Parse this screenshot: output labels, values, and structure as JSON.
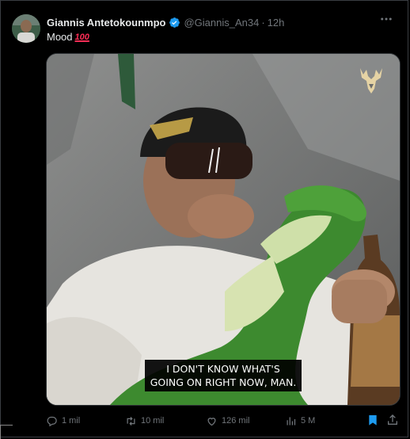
{
  "tweet": {
    "author_name": "Giannis Antetokounmpo",
    "handle": "@Giannis_An34",
    "separator": "·",
    "timestamp": "12h",
    "text": "Mood",
    "emoji": "100"
  },
  "media": {
    "caption_line1": "I DON'T KNOW WHAT'S",
    "caption_line2": "GOING ON RIGHT NOW, MAN.",
    "logo": "bucks-deer-logo"
  },
  "actions": {
    "replies": "1 mil",
    "retweets": "10 mil",
    "likes": "126 mil",
    "views": "5 M"
  },
  "icons": {
    "more": "more-icon",
    "reply": "reply-icon",
    "retweet": "retweet-icon",
    "like": "heart-icon",
    "views": "views-icon",
    "bookmark": "bookmark-icon",
    "share": "share-icon",
    "verified": "verified-badge-icon"
  },
  "colors": {
    "background": "#000000",
    "text": "#e7e9ea",
    "muted": "#71767b",
    "accent": "#1d9bf0",
    "bucks_gold": "#e5d3a4"
  }
}
